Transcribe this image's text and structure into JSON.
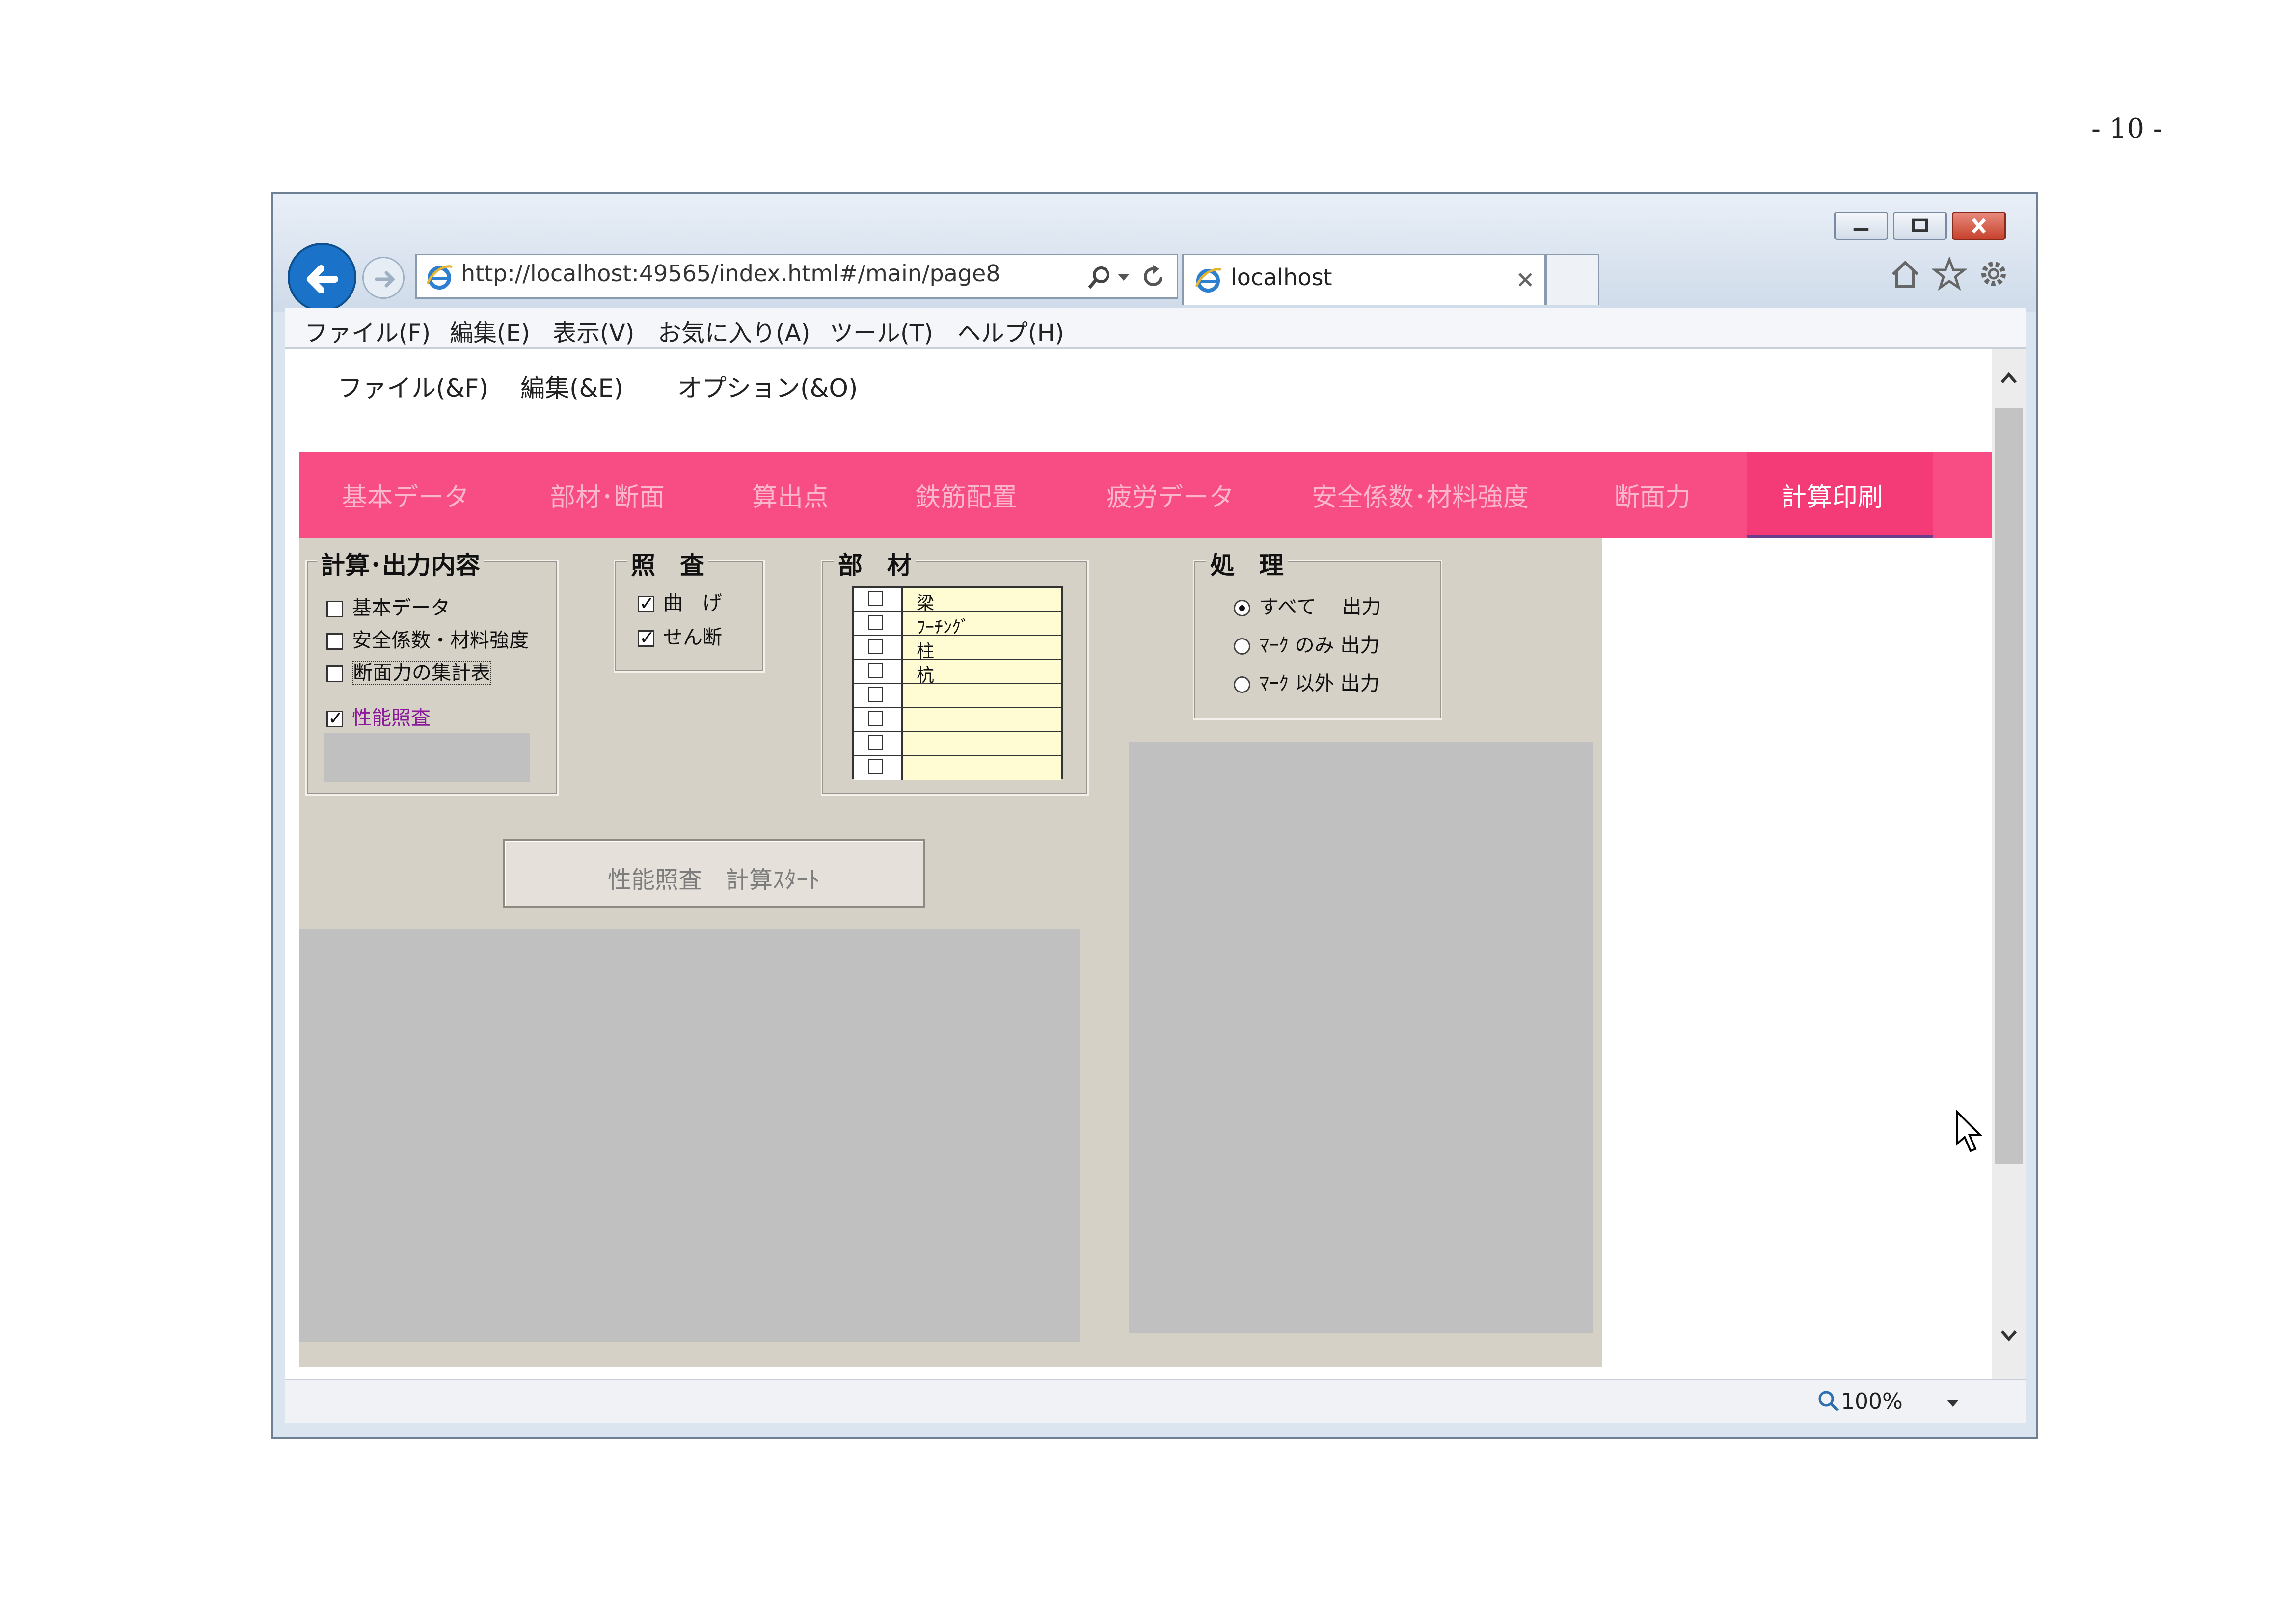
{
  "page_number": "- 10 -",
  "browser": {
    "url": "http://localhost:49565/index.html#/main/page8",
    "tab_title": "localhost",
    "menu": [
      "ファイル(F)",
      "編集(E)",
      "表示(V)",
      "お気に入り(A)",
      "ツール(T)",
      "ヘルプ(H)"
    ],
    "zoom": "100%"
  },
  "app": {
    "menu": [
      "ファイル(&F)",
      "編集(&E)",
      "オプション(&O)"
    ],
    "nav_tabs": [
      "基本データ",
      "部材･断面",
      "算出点",
      "鉄筋配置",
      "疲労データ",
      "安全係数･材料強度",
      "断面力",
      "計算印刷"
    ],
    "active_tab": "計算印刷"
  },
  "calc_output": {
    "title": "計算･出力内容",
    "items": [
      {
        "label": "基本データ",
        "checked": false
      },
      {
        "label": "安全係数・材料強度",
        "checked": false
      },
      {
        "label": "断面力の集計表",
        "checked": false
      },
      {
        "label": "性能照査",
        "checked": true
      }
    ]
  },
  "inspection": {
    "title": "照　査",
    "items": [
      {
        "label": "曲　げ",
        "checked": true
      },
      {
        "label": "せん断",
        "checked": true
      }
    ]
  },
  "members": {
    "title": "部　材",
    "rows": [
      "梁",
      "ﾌｰﾁﾝｸﾞ",
      "柱",
      "杭",
      "",
      "",
      "",
      ""
    ]
  },
  "processing": {
    "title": "処　理",
    "options": [
      {
        "label": "すべて　 出力",
        "selected": true
      },
      {
        "label": "ﾏｰｸ のみ 出力",
        "selected": false
      },
      {
        "label": "ﾏｰｸ 以外 出力",
        "selected": false
      }
    ]
  },
  "start_button": "性能照査　計算ｽﾀｰﾄ",
  "colors": {
    "nav_bg": "#f74d84",
    "nav_inactive_text": "#fbb6cc",
    "panel_bg": "#d6d1c7",
    "grid_cell": "#fffcd4"
  }
}
